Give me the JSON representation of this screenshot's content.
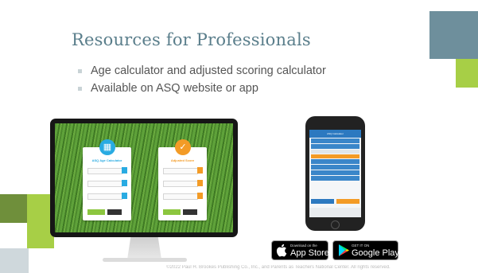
{
  "slide": {
    "title": "Resources for Professionals",
    "bullets": [
      "Age calculator and adjusted scoring calculator",
      "Available on ASQ website or app"
    ]
  },
  "monitor": {
    "left_card": {
      "title": "ASQ Age Calculator",
      "btn_calc": "Calculate",
      "btn_clear": "Clear"
    },
    "right_card": {
      "title": "Adjusted Score",
      "btn_calc": "Calculate",
      "btn_clear": "Clear"
    }
  },
  "phone": {
    "header": "ASQ Calculator"
  },
  "badges": {
    "apple": {
      "small": "Download on the",
      "big": "App Store"
    },
    "google": {
      "small": "GET IT ON",
      "big": "Google Play"
    }
  },
  "footer": "©2022 Paul H. Brookes Publishing Co., Inc., and Parents as Teachers National Center. All rights reserved.",
  "colors": {
    "title": "#5a7e8b",
    "accent_green": "#a7cf46",
    "accent_teal": "#6e8f9c",
    "calc_blue": "#29abe2",
    "calc_orange": "#f39b26"
  }
}
